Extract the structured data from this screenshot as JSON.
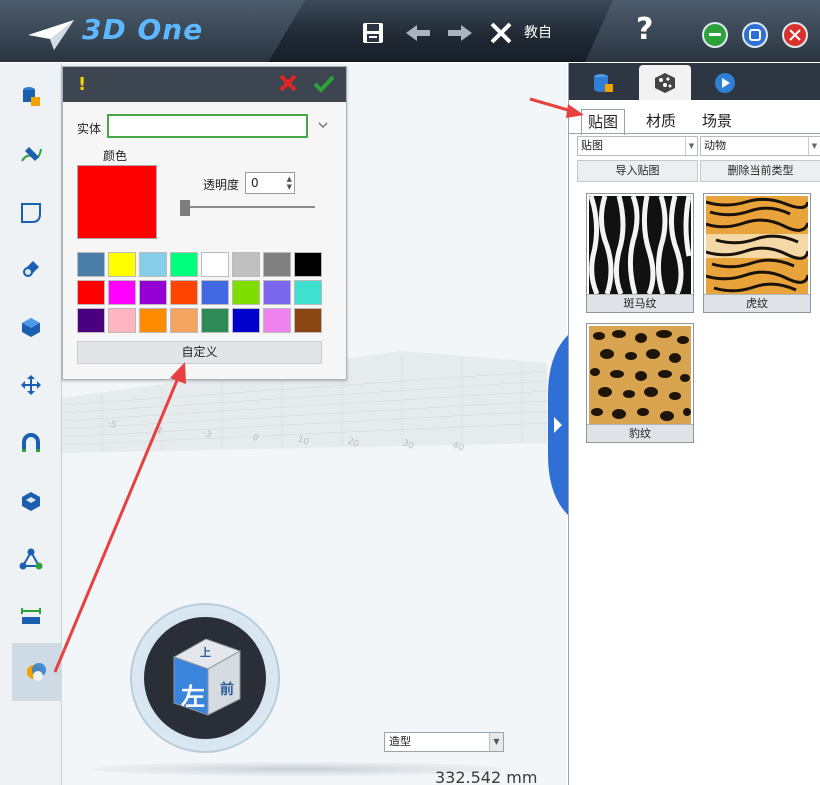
{
  "app": {
    "name": "3D One",
    "title_truncated": "教自"
  },
  "popup": {
    "entity_label": "实体",
    "entity_value": "",
    "color_label": "颜色",
    "current_color": "#ff0000",
    "transparency_label": "透明度",
    "transparency_value": "0",
    "palette": [
      "#4a7ea8",
      "#ffff00",
      "#87ceeb",
      "#00ff7f",
      "#ffffff",
      "#c0c0c0",
      "#808080",
      "#000000",
      "#ff0000",
      "#ff00ff",
      "#9400d3",
      "#ff4500",
      "#4169e1",
      "#7fdd00",
      "#7b68ee",
      "#40e0d0",
      "#4b0082",
      "#ffb6c1",
      "#ff8c00",
      "#f4a460",
      "#2e8b57",
      "#0000cd",
      "#ee82ee",
      "#8b4513"
    ],
    "custom_button": "自定义"
  },
  "viewport": {
    "mode_select": "造型",
    "status_distance": "332.542 mm"
  },
  "right_panel": {
    "sub_tabs": [
      "贴图",
      "材质",
      "场景"
    ],
    "category_select": "贴图",
    "subcategory_select": "动物",
    "import_button": "导入贴图",
    "delete_button": "删除当前类型",
    "textures": [
      "斑马纹",
      "虎纹",
      "豹纹"
    ]
  },
  "view_cube": {
    "front_face": "左",
    "top_face": "上",
    "side_face": "前"
  }
}
